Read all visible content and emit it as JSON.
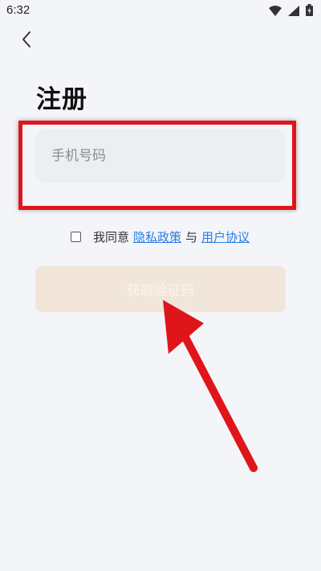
{
  "status_bar": {
    "time": "6:32"
  },
  "header": {
    "title": "注册"
  },
  "form": {
    "phone_placeholder": "手机号码",
    "phone_value": ""
  },
  "agreement": {
    "prefix": "我同意",
    "privacy_link": "隐私政策",
    "conjunction": "与",
    "terms_link": "用户协议",
    "checked": false
  },
  "submit": {
    "label": "获取验证码"
  },
  "colors": {
    "background": "#f4f5f9",
    "accent_disabled": "#f2e6da",
    "link": "#2b7de0",
    "annotation": "#e0151a"
  }
}
